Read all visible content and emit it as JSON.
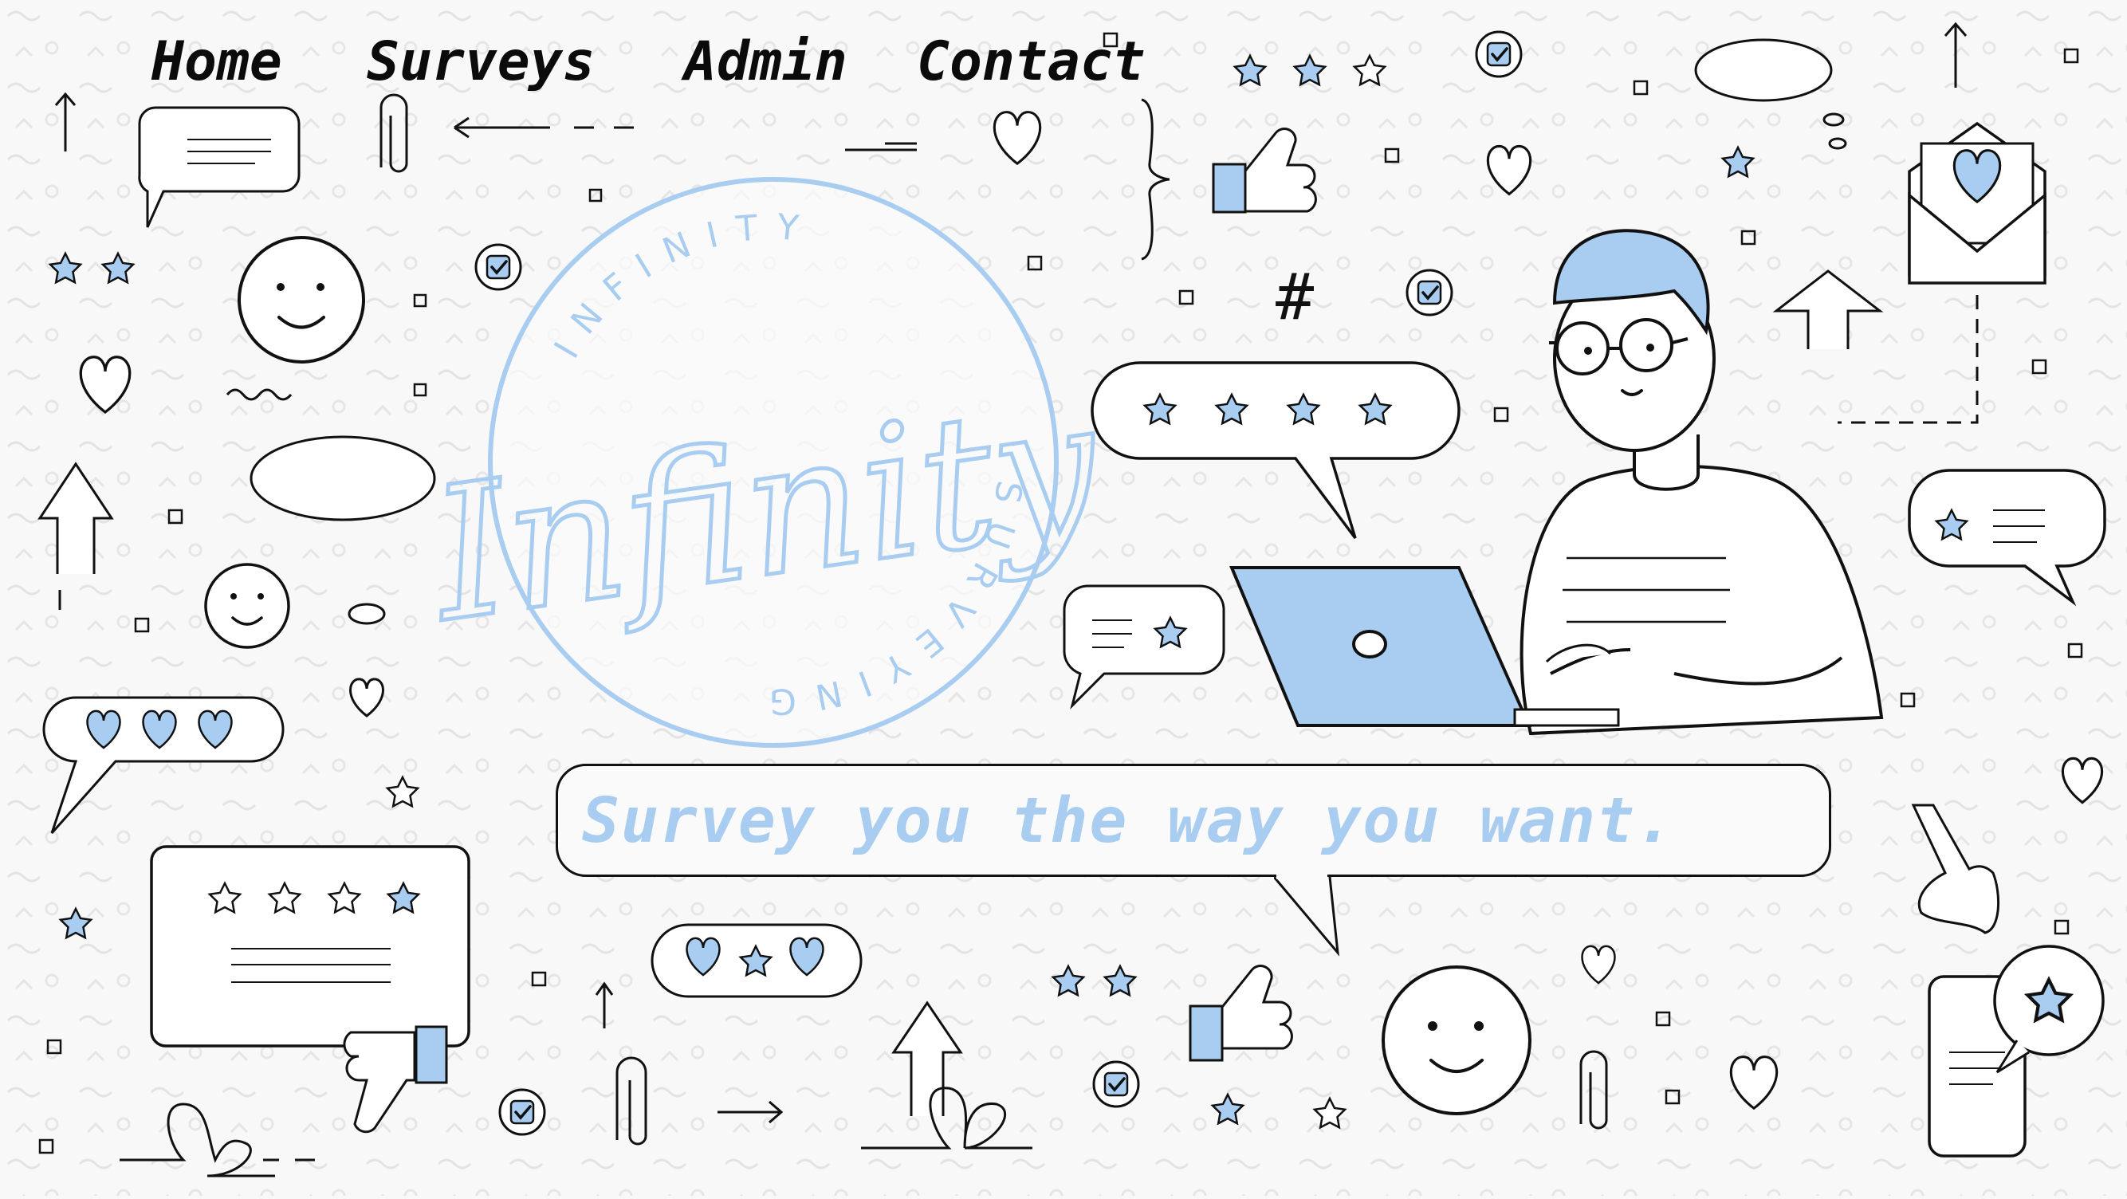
{
  "nav": {
    "items": [
      {
        "label": "Home"
      },
      {
        "label": "Surveys"
      },
      {
        "label": "Admin"
      },
      {
        "label": "Contact"
      }
    ]
  },
  "logo": {
    "script": "Infinity",
    "ring_top": "INFINITY",
    "ring_bottom": "SURVEYING"
  },
  "hero": {
    "tagline": "Survey you the way you want."
  },
  "colors": {
    "accent": "#a9cdf0",
    "ink": "#111111",
    "background": "#f8f8f8"
  }
}
